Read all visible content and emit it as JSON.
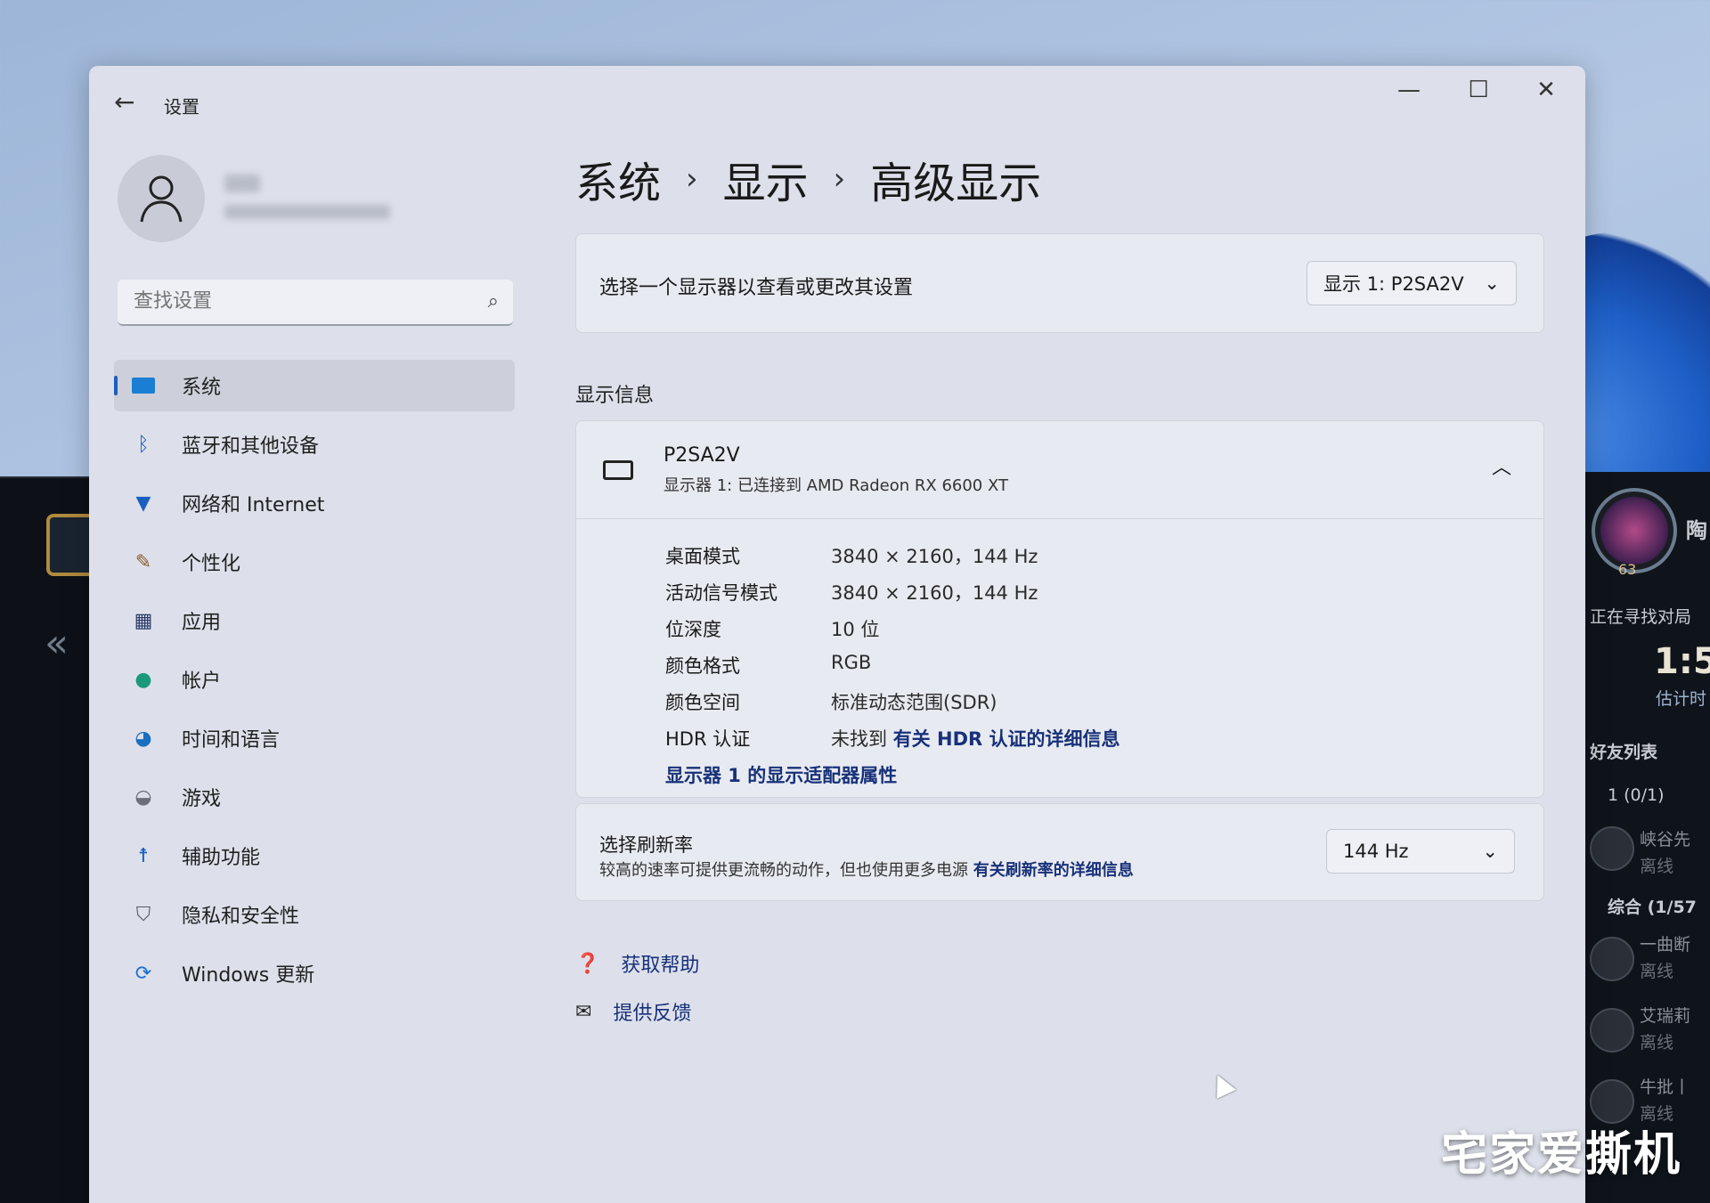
{
  "window": {
    "title": "设置",
    "minimize": "—",
    "maximize": "☐",
    "close": "✕"
  },
  "breadcrumb": {
    "level1": "系统",
    "level2": "显示",
    "level3": "高级显示",
    "separator": "›"
  },
  "search": {
    "placeholder": "查找设置"
  },
  "sidebar": {
    "items": [
      {
        "label": "系统",
        "icon": "monitor-icon",
        "active": true
      },
      {
        "label": "蓝牙和其他设备",
        "icon": "bluetooth-icon"
      },
      {
        "label": "网络和 Internet",
        "icon": "wifi-icon"
      },
      {
        "label": "个性化",
        "icon": "brush-icon"
      },
      {
        "label": "应用",
        "icon": "apps-icon"
      },
      {
        "label": "帐户",
        "icon": "account-icon"
      },
      {
        "label": "时间和语言",
        "icon": "globe-clock-icon"
      },
      {
        "label": "游戏",
        "icon": "gamepad-icon"
      },
      {
        "label": "辅助功能",
        "icon": "accessibility-icon"
      },
      {
        "label": "隐私和安全性",
        "icon": "shield-icon"
      },
      {
        "label": "Windows 更新",
        "icon": "update-icon"
      }
    ]
  },
  "select_display": {
    "label": "选择一个显示器以查看或更改其设置",
    "value": "显示 1: P2SA2V"
  },
  "display_info": {
    "section_title": "显示信息",
    "monitor_name": "P2SA2V",
    "monitor_subtitle": "显示器 1: 已连接到 AMD Radeon RX 6600 XT",
    "rows": [
      {
        "k": "桌面模式",
        "v": "3840 × 2160，144 Hz"
      },
      {
        "k": "活动信号模式",
        "v": "3840 × 2160，144 Hz"
      },
      {
        "k": "位深度",
        "v": "10 位"
      },
      {
        "k": "颜色格式",
        "v": "RGB"
      },
      {
        "k": "颜色空间",
        "v": "标准动态范围(SDR)"
      }
    ],
    "hdr_key": "HDR 认证",
    "hdr_value": "未找到",
    "hdr_link": "有关 HDR 认证的详细信息",
    "adapter_link": "显示器 1 的显示适配器属性"
  },
  "refresh": {
    "title": "选择刷新率",
    "desc": "较高的速率可提供更流畅的动作，但也使用更多电源",
    "link": "有关刷新率的详细信息",
    "value": "144 Hz"
  },
  "help": {
    "get_help": "获取帮助",
    "feedback": "提供反馈"
  },
  "game_client": {
    "level": "63",
    "char": "陶",
    "status": "正在寻找对局",
    "timer": "1:5",
    "estimate": "估计时",
    "friends_title": "好友列表",
    "group1": "1 (0/1)",
    "group2": "综合 (1/57",
    "friends": [
      {
        "name": "峡谷先",
        "state": "离线"
      },
      {
        "name": "一曲断",
        "state": "离线"
      },
      {
        "name": "艾瑞莉",
        "state": "离线"
      },
      {
        "name": "牛批丨",
        "state": "离线"
      }
    ]
  },
  "watermark": "宅家爱撕机",
  "colors": {
    "accent": "#1a5fbf",
    "link": "#17317a"
  }
}
